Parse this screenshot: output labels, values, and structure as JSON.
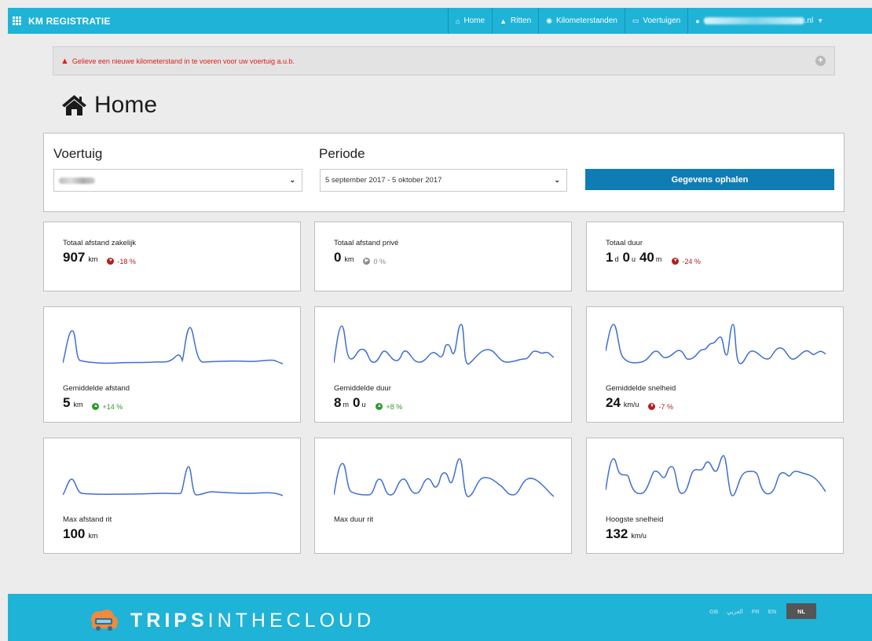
{
  "nav": {
    "brand": "KM REGISTRATIE",
    "items": [
      {
        "label": "Home",
        "icon": "home-icon"
      },
      {
        "label": "Ritten",
        "icon": "road-icon"
      },
      {
        "label": "Kilometerstanden",
        "icon": "dashboard-icon"
      },
      {
        "label": "Voertuigen",
        "icon": "car-icon"
      }
    ],
    "user": {
      "email_suffix": ".nl",
      "icon": "user-icon"
    }
  },
  "alert": {
    "text": "Gelieve een nieuwe kilometerstand in te voeren voor uw voertuig a.u.b.",
    "color": "#e0201b"
  },
  "page": {
    "title": "Home"
  },
  "filters": {
    "vehicle_label": "Voertuig",
    "period_label": "Periode",
    "period_value": "5 september 2017 - 5 oktober 2017",
    "fetch_button": "Gegevens ophalen"
  },
  "stats": {
    "business": {
      "title": "Totaal afstand zakelijk",
      "value": "907",
      "unit": "km",
      "delta": "-18 %"
    },
    "private": {
      "title": "Totaal afstand privé",
      "value": "0",
      "unit": "km",
      "delta": "0 %"
    },
    "duration": {
      "title": "Totaal duur",
      "d": "1",
      "d_unit": "d",
      "u": "0",
      "u_unit": "u",
      "m": "40",
      "m_unit": "m",
      "delta": "-24 %"
    },
    "avg_distance": {
      "title": "Gemiddelde afstand",
      "value": "5",
      "unit": "km",
      "delta": "+14 %"
    },
    "avg_duration": {
      "title": "Gemiddelde duur",
      "m": "8",
      "m_unit": "m",
      "u": "0",
      "u_unit": "u",
      "delta": "+8 %"
    },
    "avg_speed": {
      "title": "Gemiddelde snelheid",
      "value": "24",
      "unit": "km/u",
      "delta": "-7 %"
    },
    "max_distance": {
      "title": "Max afstand rit",
      "value": "100",
      "unit": "km"
    },
    "max_duration": {
      "title": "Max duur rit"
    },
    "max_speed": {
      "title": "Hoogste snelheid",
      "value": "132",
      "unit": "km/u"
    }
  },
  "colors": {
    "accent": "#1fb3d7",
    "button": "#0f7db4",
    "spark": "#3f6fd2",
    "down": "#b61d1d",
    "up": "#2c9a2c"
  },
  "footer": {
    "logo_bold": "TRIPS",
    "logo_light": "INTHECLOUD",
    "languages": [
      "GB",
      "العربي",
      "FR",
      "EN",
      "NL"
    ],
    "active_language": "NL"
  }
}
